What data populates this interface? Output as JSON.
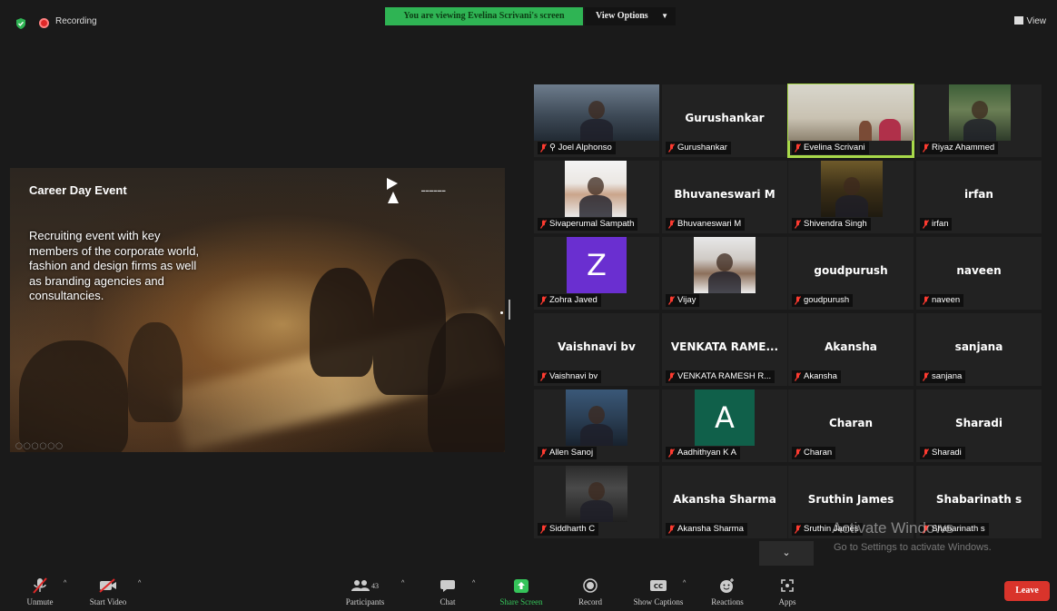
{
  "top_bar": {
    "recording_label": "Recording",
    "share_banner": "You are viewing Evelina Scrivani's screen",
    "view_options_label": "View Options",
    "view_label": "View"
  },
  "slide": {
    "title": "Career Day Event",
    "body": "Recruiting event with key members of the corporate world, fashion and design firms as well as branding agencies and consultancies."
  },
  "participants": [
    {
      "big_name": "",
      "label": "Joel Alphonso",
      "pinned": true,
      "kind": "video"
    },
    {
      "big_name": "Gurushankar",
      "label": "Gurushankar",
      "kind": "name"
    },
    {
      "big_name": "",
      "label": "Evelina Scrivani",
      "kind": "video",
      "active": true
    },
    {
      "big_name": "",
      "label": "Riyaz Ahammed",
      "kind": "photo"
    },
    {
      "big_name": "",
      "label": "Sivaperumal Sampath",
      "kind": "photo"
    },
    {
      "big_name": "Bhuvaneswari M",
      "label": "Bhuvaneswari M",
      "kind": "name"
    },
    {
      "big_name": "",
      "label": "Shivendra Singh",
      "kind": "photo"
    },
    {
      "big_name": "irfan",
      "label": "irfan",
      "kind": "name"
    },
    {
      "big_name": "Z",
      "label": "Zohra Javed",
      "kind": "letter",
      "color": "#6a2fd0"
    },
    {
      "big_name": "",
      "label": "Vijay",
      "kind": "photo"
    },
    {
      "big_name": "goudpurush",
      "label": "goudpurush",
      "kind": "name"
    },
    {
      "big_name": "naveen",
      "label": "naveen",
      "kind": "name"
    },
    {
      "big_name": "Vaishnavi bv",
      "label": "Vaishnavi bv",
      "kind": "name"
    },
    {
      "big_name": "VENKATA RAME...",
      "label": "VENKATA RAMESH R...",
      "kind": "name"
    },
    {
      "big_name": "Akansha",
      "label": "Akansha",
      "kind": "name"
    },
    {
      "big_name": "sanjana",
      "label": "sanjana",
      "kind": "name"
    },
    {
      "big_name": "",
      "label": "Allen Sanoj",
      "kind": "photo"
    },
    {
      "big_name": "A",
      "label": "Aadhithyan K A",
      "kind": "letter",
      "color": "#10604a"
    },
    {
      "big_name": "Charan",
      "label": "Charan",
      "kind": "name"
    },
    {
      "big_name": "Sharadi",
      "label": "Sharadi",
      "kind": "name"
    },
    {
      "big_name": "",
      "label": "Siddharth C",
      "kind": "photo"
    },
    {
      "big_name": "Akansha Sharma",
      "label": "Akansha Sharma",
      "kind": "name"
    },
    {
      "big_name": "Sruthin James",
      "label": "Sruthin James",
      "kind": "name"
    },
    {
      "big_name": "Shabarinath s",
      "label": "Shabarinath s",
      "kind": "name"
    }
  ],
  "watermark": {
    "line1": "Activate Windows",
    "line2": "Go to Settings to activate Windows."
  },
  "toolbar": {
    "unmute": "Unmute",
    "start_video": "Start Video",
    "participants": "Participants",
    "participants_count": "43",
    "chat": "Chat",
    "share_screen": "Share Screen",
    "record": "Record",
    "show_captions": "Show Captions",
    "reactions": "Reactions",
    "apps": "Apps",
    "leave": "Leave"
  },
  "colors": {
    "share_green": "#2fb454",
    "active_speaker": "#a8d94a",
    "leave_red": "#d9342b",
    "muted_red": "#e02828"
  }
}
